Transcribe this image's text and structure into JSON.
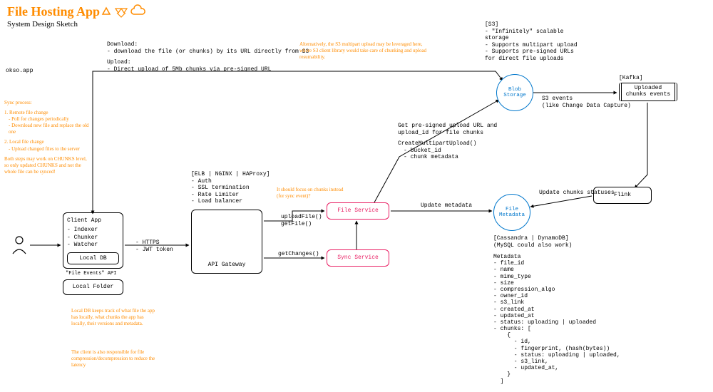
{
  "header": {
    "title": "File Hosting App",
    "subtitle": "System Design Sketch",
    "attribution": "okso.app",
    "icons": [
      "gdrive-icon",
      "dropbox-icon",
      "cloud-icon"
    ]
  },
  "protocol": {
    "download_label": "Download:",
    "download_text": "- download the file (or chunks) by its URL directly from S3",
    "upload_label": "Upload:",
    "upload_text": "- Direct upload of 5Mb chunks via pre-signed URL"
  },
  "notes": {
    "multipart": "Alternatively, the S3 multipart upload may be leveraged here, where S3 client library would take care of chunking and upload resumability.",
    "sync_title": "Sync process:",
    "sync_1_title": "1. Remote file change",
    "sync_1a": "- Poll for changes periodically",
    "sync_1b": "- Download new file and replace the old one",
    "sync_2_title": "2. Local file change",
    "sync_2a": "- Upload changed files to the server",
    "sync_footer": "Both steps may work on CHUNKS level, so only updated CHUNKS and not the whole file can be synced!",
    "local_db_note": "Local DB keeps track of what file the app has locally, what chunks the app has locally, their versions and metadata.",
    "client_note": "The client is also responsible for file compression/decompression to reduce the latency",
    "file_service_note": "It should focus on chunks instead (for sync event)?"
  },
  "client": {
    "title": "Client App",
    "indexer": "- Indexer",
    "chunker": "- Chunker",
    "watcher": "- Watcher",
    "local_db": "Local DB",
    "file_events_api": "\"File Events\" API",
    "local_folder": "Local Folder"
  },
  "edges": {
    "https": "- HTTPS",
    "jwt": "- JWT token",
    "get_changes": "getChanges()",
    "upload_file": "uploadFile()",
    "get_file": "getFile()",
    "update_metadata": "Update metadata",
    "update_chunks": "Update chunks statuses",
    "s3_events_1": "S3 events",
    "s3_events_2": "(like Change Data Capture)",
    "presigned_1": "Get pre-signed upload URL and",
    "presigned_2": "upload_id for file chunks",
    "multipart_call": "CreateMultipartUpload()",
    "multipart_bucket": "- bucket_id",
    "multipart_meta": "- chunk metadata"
  },
  "api_gateway": {
    "title": "API Gateway",
    "header": "[ELB | NGINX | HAProxy]",
    "auth": "- Auth",
    "ssl": "- SSL termination",
    "rate": "- Rate Limiter",
    "lb": "- Load balancer"
  },
  "services": {
    "file_service": "File Service",
    "sync_service": "Sync Service",
    "flink": "Flink"
  },
  "storage": {
    "blob": "Blob Storage",
    "file_meta": "File Metadata",
    "s3_header": "[S3]",
    "s3_1": "- \"Infinitely\" scalable storage",
    "s3_2": "- Supports multipart upload",
    "s3_3": "- Supports pre-signed URLs for direct file uploads",
    "kafka_header": "[Kafka]",
    "kafka_box_1": "Uploaded",
    "kafka_box_2": "chunks events",
    "db_header": "[Cassandra | DynamoDB]",
    "db_sub": "(MySQL could also work)",
    "meta_title": "Metadata",
    "meta": [
      "- file_id",
      "- name",
      "- mime_type",
      "- size",
      "- compression_algo",
      "- owner_id",
      "- s3_link",
      "- created_at",
      "- updated_at",
      "- status: uploading | uploaded",
      "- chunks: [",
      "    {",
      "      - id,",
      "      - fingerprint, (hash(bytes))",
      "      - status: uploading | uploaded,",
      "      - s3_link,",
      "      - updated_at,",
      "    }",
      "  ]"
    ]
  }
}
